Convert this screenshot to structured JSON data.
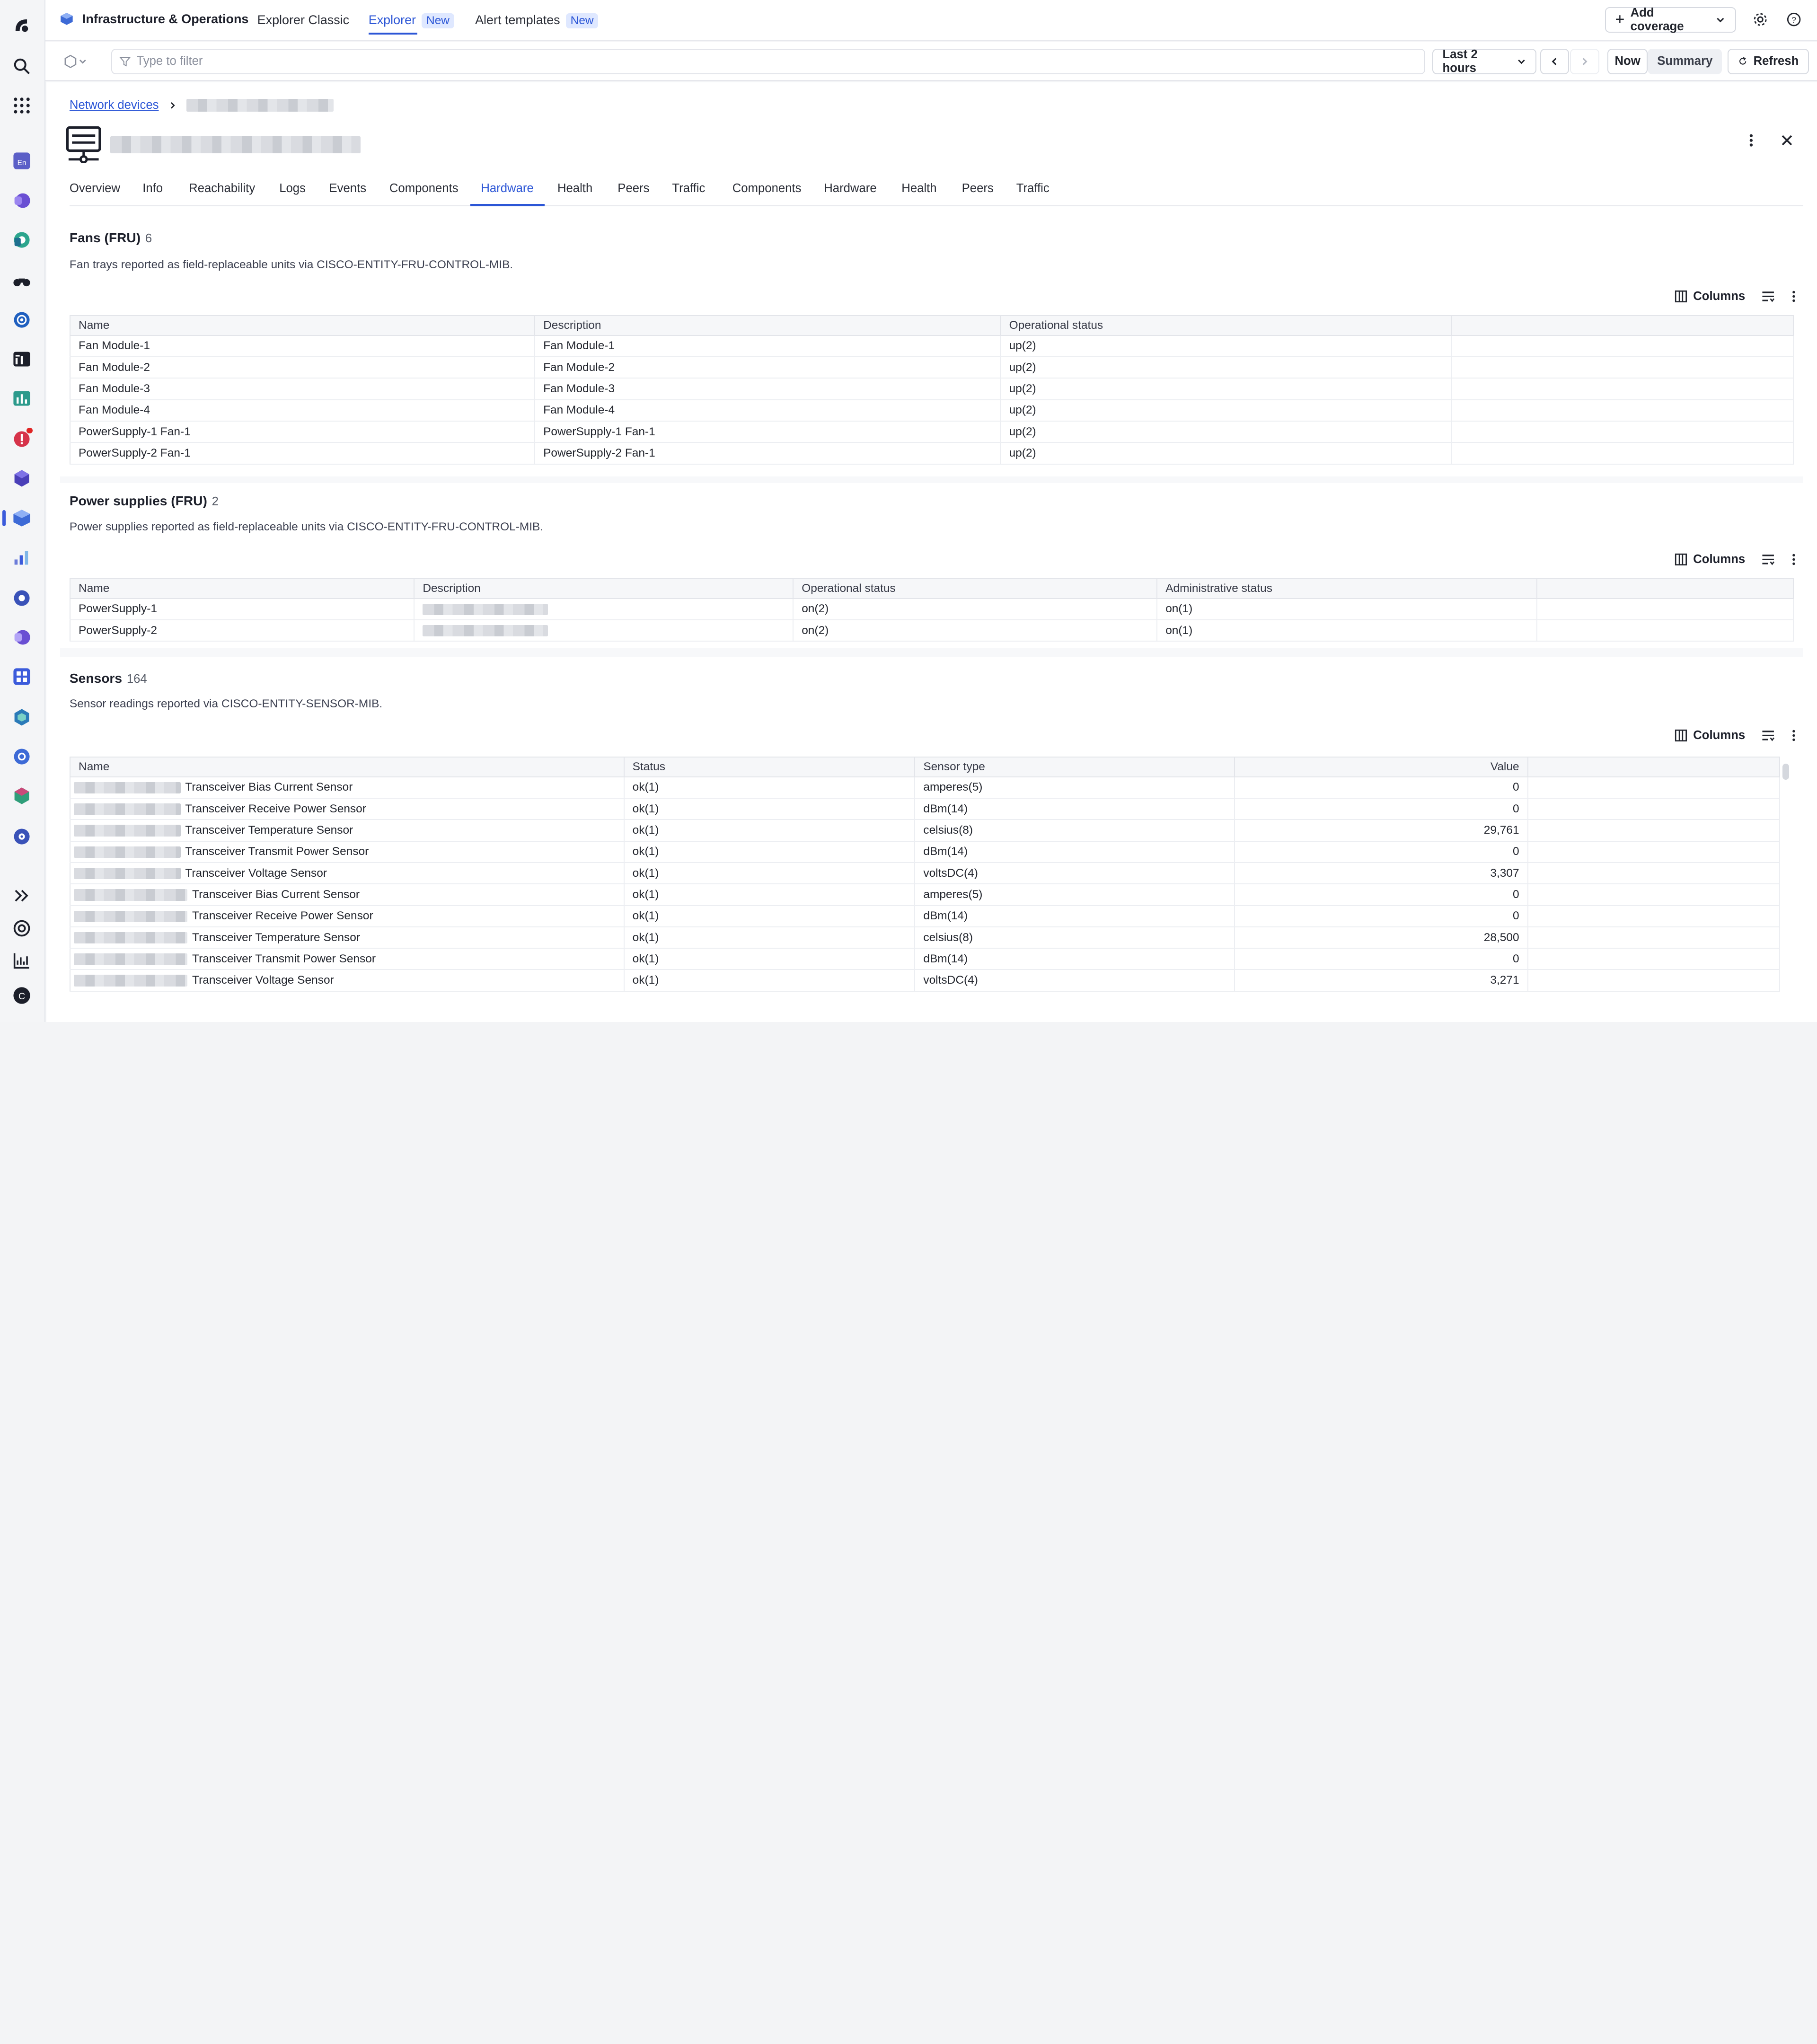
{
  "app": {
    "brand": "Infrastructure & Operations",
    "tabs": [
      {
        "label": "Explorer Classic"
      },
      {
        "label": "Explorer",
        "badge": "New"
      },
      {
        "label": "Alert templates",
        "badge": "New"
      }
    ],
    "add_coverage": "Add coverage"
  },
  "filter": {
    "placeholder": "Type to filter",
    "timeframe": "Last 2 hours",
    "now": "Now",
    "summary": "Summary",
    "refresh": "Refresh"
  },
  "breadcrumb": {
    "root": "Network devices"
  },
  "tabs": [
    "Overview",
    "Info",
    "Reachability",
    "Logs",
    "Events",
    "Components",
    "Hardware",
    "Health",
    "Peers",
    "Traffic",
    "Components",
    "Hardware",
    "Health",
    "Peers",
    "Traffic"
  ],
  "active_tab": "Hardware",
  "toolbar": {
    "columns": "Columns"
  },
  "fans": {
    "title": "Fans (FRU)",
    "count": "6",
    "description": "Fan trays reported as field-replaceable units via CISCO-ENTITY-FRU-CONTROL-MIB.",
    "columns": [
      "Name",
      "Description",
      "Operational status"
    ],
    "rows": [
      [
        "Fan Module-1",
        "Fan Module-1",
        "up(2)"
      ],
      [
        "Fan Module-2",
        "Fan Module-2",
        "up(2)"
      ],
      [
        "Fan Module-3",
        "Fan Module-3",
        "up(2)"
      ],
      [
        "Fan Module-4",
        "Fan Module-4",
        "up(2)"
      ],
      [
        "PowerSupply-1 Fan-1",
        "PowerSupply-1 Fan-1",
        "up(2)"
      ],
      [
        "PowerSupply-2 Fan-1",
        "PowerSupply-2 Fan-1",
        "up(2)"
      ]
    ]
  },
  "power": {
    "title": "Power supplies (FRU)",
    "count": "2",
    "description": "Power supplies reported as field-replaceable units via CISCO-ENTITY-FRU-CONTROL-MIB.",
    "columns": [
      "Name",
      "Description",
      "Operational status",
      "Administrative status"
    ],
    "rows": [
      [
        "PowerSupply-1",
        "",
        "on(2)",
        "on(1)"
      ],
      [
        "PowerSupply-2",
        "",
        "on(2)",
        "on(1)"
      ]
    ]
  },
  "sensors": {
    "title": "Sensors",
    "count": "164",
    "description": "Sensor readings reported via CISCO-ENTITY-SENSOR-MIB.",
    "columns": [
      "Name",
      "Status",
      "Sensor type",
      "Value"
    ],
    "rows": [
      [
        "Transceiver Bias Current Sensor",
        "ok(1)",
        "amperes(5)",
        "0"
      ],
      [
        "Transceiver Receive Power Sensor",
        "ok(1)",
        "dBm(14)",
        "0"
      ],
      [
        "Transceiver Temperature Sensor",
        "ok(1)",
        "celsius(8)",
        "29,761"
      ],
      [
        "Transceiver Transmit Power Sensor",
        "ok(1)",
        "dBm(14)",
        "0"
      ],
      [
        "Transceiver Voltage Sensor",
        "ok(1)",
        "voltsDC(4)",
        "3,307"
      ],
      [
        "Transceiver Bias Current Sensor",
        "ok(1)",
        "amperes(5)",
        "0"
      ],
      [
        "Transceiver Receive Power Sensor",
        "ok(1)",
        "dBm(14)",
        "0"
      ],
      [
        "Transceiver Temperature Sensor",
        "ok(1)",
        "celsius(8)",
        "28,500"
      ],
      [
        "Transceiver Transmit Power Sensor",
        "ok(1)",
        "dBm(14)",
        "0"
      ],
      [
        "Transceiver Voltage Sensor",
        "ok(1)",
        "voltsDC(4)",
        "3,271"
      ]
    ]
  },
  "colors": {
    "accent": "#2c56d6",
    "rail_active": "#3b5bdb",
    "alert": "#e02424"
  },
  "rail_icons": [
    "app-logo-icon",
    "search-icon",
    "apps-grid-icon",
    "en-app-icon",
    "app-icon",
    "app-icon",
    "binoculars-icon",
    "app-icon",
    "terminal-icon",
    "chart-icon",
    "alert-icon",
    "cube-stack-icon",
    "infrastructure-icon",
    "chart-icon",
    "gear-icon",
    "app-icon",
    "grid-icon",
    "hexagon-icon",
    "kubernetes-icon",
    "cube-icon",
    "gear-icon",
    "expand-icon",
    "help-icon",
    "stats-icon",
    "user-avatar-icon"
  ]
}
